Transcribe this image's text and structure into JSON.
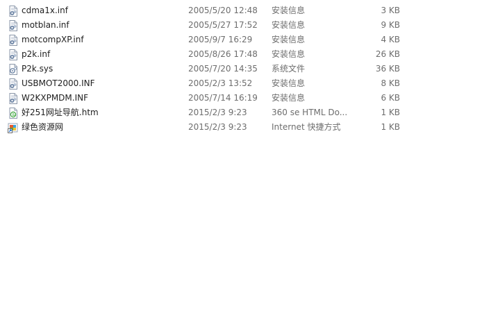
{
  "files": [
    {
      "name": "cdma1x.inf",
      "date": "2005/5/20 12:48",
      "type": "安装信息",
      "size": "3 KB",
      "icon": "inf-file-icon"
    },
    {
      "name": "motblan.inf",
      "date": "2005/5/27 17:52",
      "type": "安装信息",
      "size": "9 KB",
      "icon": "inf-file-icon"
    },
    {
      "name": "motcompXP.inf",
      "date": "2005/9/7 16:29",
      "type": "安装信息",
      "size": "4 KB",
      "icon": "inf-file-icon"
    },
    {
      "name": "p2k.inf",
      "date": "2005/8/26 17:48",
      "type": "安装信息",
      "size": "26 KB",
      "icon": "inf-file-icon"
    },
    {
      "name": "P2k.sys",
      "date": "2005/7/20 14:35",
      "type": "系统文件",
      "size": "36 KB",
      "icon": "sys-file-icon"
    },
    {
      "name": "USBMOT2000.INF",
      "date": "2005/2/3 13:52",
      "type": "安装信息",
      "size": "8 KB",
      "icon": "inf-file-icon"
    },
    {
      "name": "W2KXPMDM.INF",
      "date": "2005/7/14 16:19",
      "type": "安装信息",
      "size": "6 KB",
      "icon": "inf-file-icon"
    },
    {
      "name": "好251网址导航.htm",
      "date": "2015/2/3 9:23",
      "type": "360 se HTML Do...",
      "size": "1 KB",
      "icon": "htm-file-icon"
    },
    {
      "name": "绿色资源网",
      "date": "2015/2/3 9:23",
      "type": "Internet 快捷方式",
      "size": "1 KB",
      "icon": "internet-shortcut-icon"
    }
  ]
}
